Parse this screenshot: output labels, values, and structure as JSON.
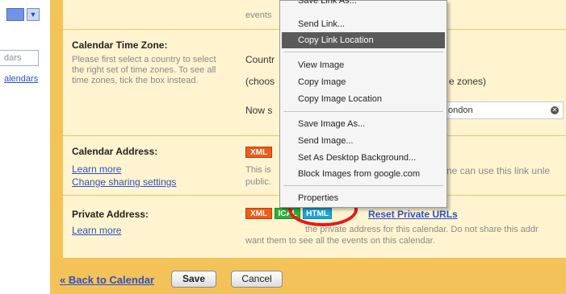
{
  "sidebar": {
    "input_value": "dars",
    "link_label": "alendars"
  },
  "rows": {
    "events_text": "events",
    "timezone": {
      "label": "Calendar Time Zone:",
      "description": "Please first select a country to select the right set of time zones. To see all time zones, tick the box instead.",
      "country_label": "Countr",
      "choose_text": "(choos",
      "zones_text": "e zones)",
      "now_text": "Now s",
      "zone_value": "ondon"
    },
    "address": {
      "label": "Calendar Address:",
      "learn_more": "Learn more",
      "change_sharing": "Change sharing settings",
      "xml_badge": "XML",
      "desc_line1": "This is",
      "desc_line1_right": "ne can use this link unle",
      "desc_line2": "public."
    },
    "private": {
      "label": "Private Address:",
      "learn_more": "Learn more",
      "xml_badge": "XML",
      "ical_badge": "ICAL",
      "html_badge": "HTML",
      "reset_link": "Reset Private URLs",
      "desc_line1": "the private address for this calendar. Do not share this addr",
      "desc_line2": "want them to see all the events on this calendar."
    }
  },
  "bottom": {
    "back_link": "« Back to Calendar",
    "save_label": "Save",
    "cancel_label": "Cancel"
  },
  "context_menu": {
    "items": [
      "Save Link As...",
      "Send Link...",
      "Copy Link Location",
      "View Image",
      "Copy Image",
      "Copy Image Location",
      "Save Image As...",
      "Send Image...",
      "Set As Desktop Background...",
      "Block Images from google.com",
      "Properties"
    ],
    "highlighted_index": 2
  },
  "colors": {
    "frame": "#f3c35a",
    "panel": "#fff4cf",
    "link": "#2d50c8",
    "xml": "#f05a1a",
    "highlight": "#5a5a5a",
    "circle": "#e8181b"
  }
}
